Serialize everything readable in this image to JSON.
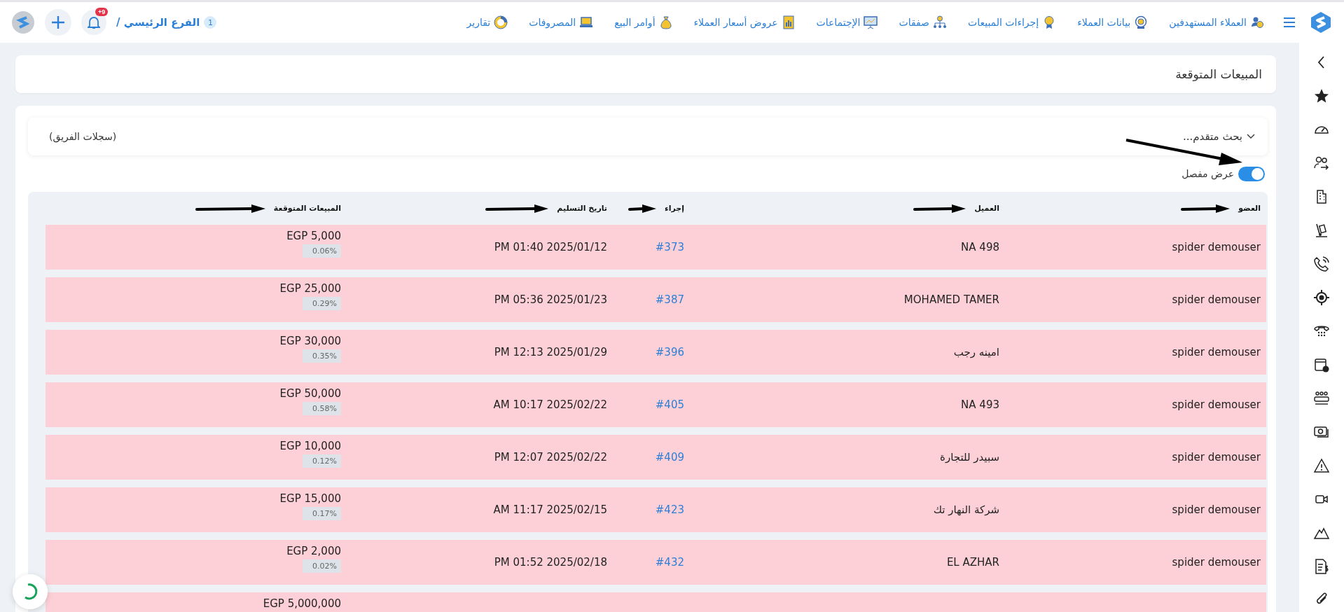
{
  "topbar": {
    "nav_items": [
      "العملاء المستهدفين",
      "بيانات العملاء",
      "إجراءات المبيعات",
      "صفقات",
      "الإجتماعات",
      "عروض أسعار العملاء",
      "أوامر البيع",
      "المصروفات",
      "تقارير"
    ],
    "branch": {
      "count": "1",
      "name": "الفرع الرئيسي /"
    },
    "notifications_badge": "+9"
  },
  "page_title": "المبيعات المتوقعة",
  "filter": {
    "advanced_search": "بحث متقدم...",
    "scope": "(سجلات الفريق)"
  },
  "detailed_view": {
    "label": "عرض مفصل",
    "on": true
  },
  "table": {
    "columns": [
      "العضو",
      "العميل",
      "إجراء",
      "تاريخ التسليم",
      "المبيعات المتوقعة"
    ],
    "rows": [
      {
        "member": "spider demouser",
        "client": "NA 498",
        "action": "#373",
        "delivery_date": "PM 01:40 2025/01/12",
        "amount": "EGP 5,000",
        "share": "0.06%"
      },
      {
        "member": "spider demouser",
        "client": "MOHAMED TAMER",
        "action": "#387",
        "delivery_date": "PM 05:36 2025/01/23",
        "amount": "EGP 25,000",
        "share": "0.29%"
      },
      {
        "member": "spider demouser",
        "client": "امينه رجب",
        "action": "#396",
        "delivery_date": "PM 12:13 2025/01/29",
        "amount": "EGP 30,000",
        "share": "0.35%"
      },
      {
        "member": "spider demouser",
        "client": "NA 493",
        "action": "#405",
        "delivery_date": "AM 10:17 2025/02/22",
        "amount": "EGP 50,000",
        "share": "0.58%"
      },
      {
        "member": "spider demouser",
        "client": "سبيدر للتجارة",
        "action": "#409",
        "delivery_date": "PM 12:07 2025/02/22",
        "amount": "EGP 10,000",
        "share": "0.12%"
      },
      {
        "member": "spider demouser",
        "client": "شركة النهار تك",
        "action": "#423",
        "delivery_date": "AM 11:17 2025/02/15",
        "amount": "EGP 15,000",
        "share": "0.17%"
      },
      {
        "member": "spider demouser",
        "client": "EL AZHAR",
        "action": "#432",
        "delivery_date": "PM 01:52 2025/02/18",
        "amount": "EGP 2,000",
        "share": "0.02%"
      },
      {
        "amount": "EGP 5,000,000"
      }
    ]
  }
}
